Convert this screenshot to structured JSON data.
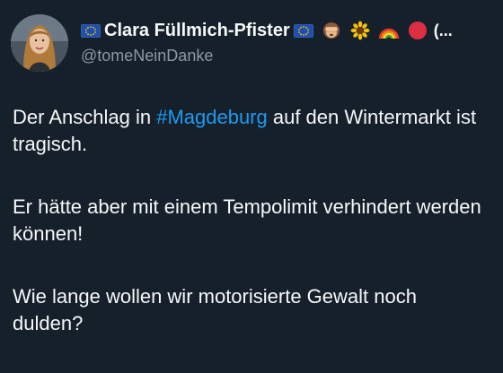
{
  "user": {
    "display_name": "Clara Füllmich-Pfister",
    "handle": "@tomeNeinDanke",
    "truncation": "(..."
  },
  "icons": {
    "flag_left": "eu-flag-icon",
    "flag_right": "eu-flag-icon",
    "emoji": [
      "see-no-evil-monkey-icon",
      "sunflower-icon",
      "rainbow-icon",
      "red-circle-icon"
    ]
  },
  "tweet": {
    "p1_before": "Der Anschlag in ",
    "p1_hashtag": "#Magdeburg",
    "p1_after": " auf den Wintermarkt ist tragisch.",
    "p2": "Er hätte aber mit einem Tempolimit verhindert werden können!",
    "p3": "Wie lange wollen wir motorisierte Gewalt noch dulden?"
  },
  "colors": {
    "background": "#15202b",
    "text": "#f7f9f9",
    "secondary": "#8b98a5",
    "link": "#1d9bf0"
  }
}
